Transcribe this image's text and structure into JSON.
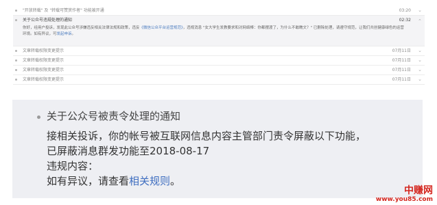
{
  "notifications": [
    {
      "text": "\"开放转载\" 及 \"转载可赞赏作者\" 功能被开通",
      "time": "03:20"
    },
    {
      "text": "文章转载权限变更提示",
      "time": "07月11日"
    },
    {
      "text": "文章转载权限变更提示",
      "time": "07月11日"
    },
    {
      "text": "文章转载权限变更提示",
      "time": "07月11日"
    },
    {
      "text": "文章转载权限变更提示",
      "time": "07月11日"
    }
  ],
  "expanded": {
    "title": "关于公众号违规处理的通知",
    "time": "02:32",
    "body_before": "你好，经用户投诉，发现此公众号涉嫌违反相关法律法规和政策，违反",
    "body_link": "《微信公众平台运营规范》",
    "body_after": "，违规消息 \"女大学生发教要求和对网络棒：你都摆渡了，为什么不敢瞧文？\" 已删除处理，请遵守规范，让我们共创健康绿色的运营环境。如有异议，可",
    "body_link2": "发起申诉",
    "body_end": "。"
  },
  "detail": {
    "title": "关于公众号被责令处理的通知",
    "line1": "接相关投诉，你的帐号被互联网信息内容主管部门责令屏蔽以下功能，",
    "line2": "已屏蔽消息群发功能至2018-08-17",
    "line3": "违规内容：",
    "line4_prefix": "如有异议，请查看",
    "line4_link": "相关规则",
    "line4_suffix": "。"
  },
  "watermark": {
    "name": "中赚网",
    "url": "www.you85.com"
  },
  "colors": {
    "link": "#3f6ec0",
    "panel_bg": "#eeeff3",
    "watermark": "#d4261e"
  }
}
